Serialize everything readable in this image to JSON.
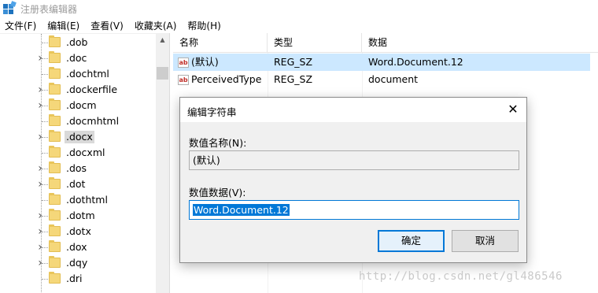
{
  "window": {
    "title": "注册表编辑器"
  },
  "menu": [
    "文件(F)",
    "编辑(E)",
    "查看(V)",
    "收藏夹(A)",
    "帮助(H)"
  ],
  "tree": {
    "items": [
      {
        "label": ".dob",
        "expandable": false,
        "selected": false
      },
      {
        "label": ".doc",
        "expandable": true,
        "selected": false
      },
      {
        "label": ".dochtml",
        "expandable": false,
        "selected": false
      },
      {
        "label": ".dockerfile",
        "expandable": true,
        "selected": false
      },
      {
        "label": ".docm",
        "expandable": true,
        "selected": false
      },
      {
        "label": ".docmhtml",
        "expandable": false,
        "selected": false
      },
      {
        "label": ".docx",
        "expandable": true,
        "selected": true
      },
      {
        "label": ".docxml",
        "expandable": false,
        "selected": false
      },
      {
        "label": ".dos",
        "expandable": true,
        "selected": false
      },
      {
        "label": ".dot",
        "expandable": true,
        "selected": false
      },
      {
        "label": ".dothtml",
        "expandable": false,
        "selected": false
      },
      {
        "label": ".dotm",
        "expandable": true,
        "selected": false
      },
      {
        "label": ".dotx",
        "expandable": true,
        "selected": false
      },
      {
        "label": ".dox",
        "expandable": true,
        "selected": false
      },
      {
        "label": ".dqy",
        "expandable": true,
        "selected": false
      },
      {
        "label": ".dri",
        "expandable": false,
        "selected": false
      }
    ]
  },
  "list": {
    "columns": {
      "name": "名称",
      "type": "类型",
      "data": "数据"
    },
    "rows": [
      {
        "icon": "string-value-icon",
        "name": "(默认)",
        "type": "REG_SZ",
        "data": "Word.Document.12",
        "selected": true
      },
      {
        "icon": "string-value-icon",
        "name": "PerceivedType",
        "type": "REG_SZ",
        "data": "document",
        "selected": false
      }
    ],
    "value_icon_text": "ab"
  },
  "dialog": {
    "title": "编辑字符串",
    "name_label": "数值名称(N):",
    "name_value": "(默认)",
    "data_label": "数值数据(V):",
    "data_value": "Word.Document.12",
    "ok_label": "确定",
    "cancel_label": "取消"
  },
  "watermark": "http://blog.csdn.net/gl486546",
  "colors": {
    "selection": "#cce8ff",
    "accent": "#0078d7"
  }
}
